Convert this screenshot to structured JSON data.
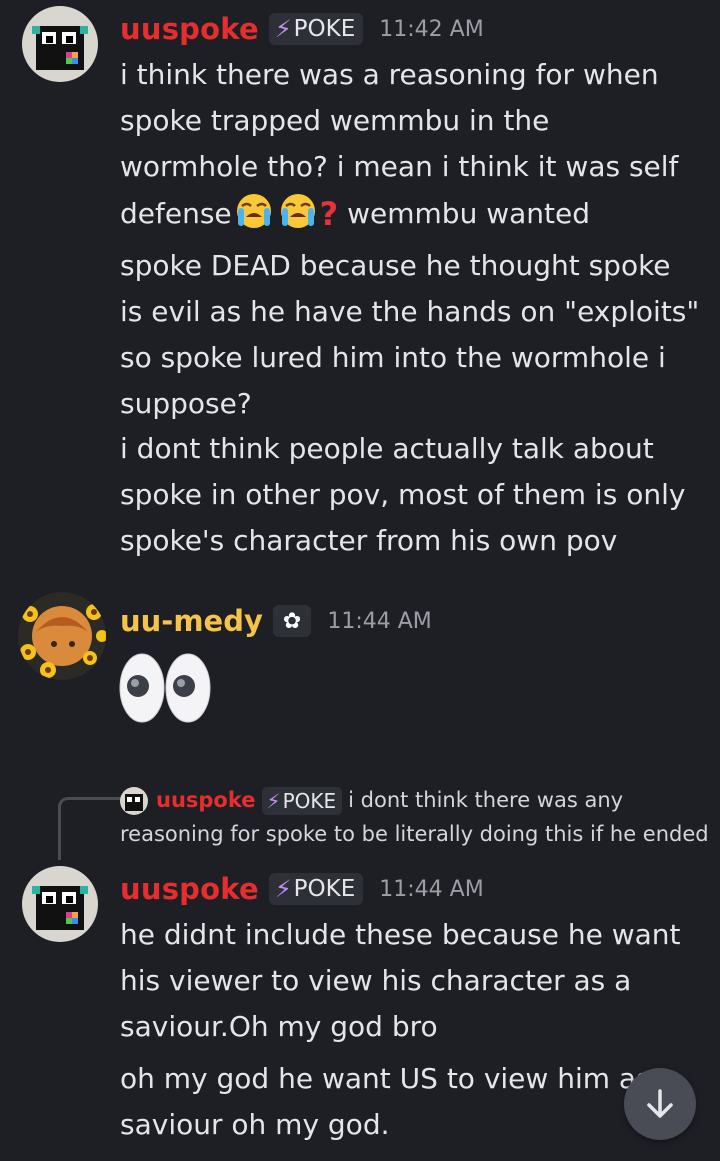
{
  "messages": [
    {
      "username": "uuspoke",
      "tag": "POKE",
      "time": "11:42 AM",
      "lines": [
        "i think there was a reasoning for when",
        "spoke trapped wemmbu in the",
        "wormhole tho? i mean i think it was self",
        "defense",
        " wemmbu wanted",
        "spoke DEAD because he thought spoke",
        "is evil as he have the hands on \"exploits\"",
        "so spoke lured him into the wormhole i",
        "suppose?"
      ],
      "emojis": [
        "crying-face-emoji",
        "crying-face-emoji",
        "red-question-mark-emoji"
      ],
      "followup": [
        "i dont think people actually talk about",
        "spoke in other pov, most of them is only",
        "spoke's character from his own pov"
      ]
    },
    {
      "username": "uu-medy",
      "badge": "flower-badge",
      "time": "11:44 AM",
      "emoji": "eyes-emoji"
    },
    {
      "reply_to": {
        "username": "uuspoke",
        "tag": "POKE",
        "text_line1": "i dont think there was any",
        "text_line2": "reasoning for spoke to be literally doing this if he ended"
      },
      "username": "uuspoke",
      "tag": "POKE",
      "time": "11:44 AM",
      "lines": [
        "he didnt include these because he want",
        "his viewer to view his character as a",
        "saviour.Oh my god bro"
      ],
      "followup": [
        "oh my god he want US to view him as",
        "saviour oh my god."
      ]
    }
  ],
  "scroll_button_icon": "arrow-down-icon",
  "colors": {
    "background": "#1e1f24",
    "username_red": "#e62e2e",
    "username_yellow": "#f5c24a",
    "tag_bolt": "#c68cf2"
  }
}
